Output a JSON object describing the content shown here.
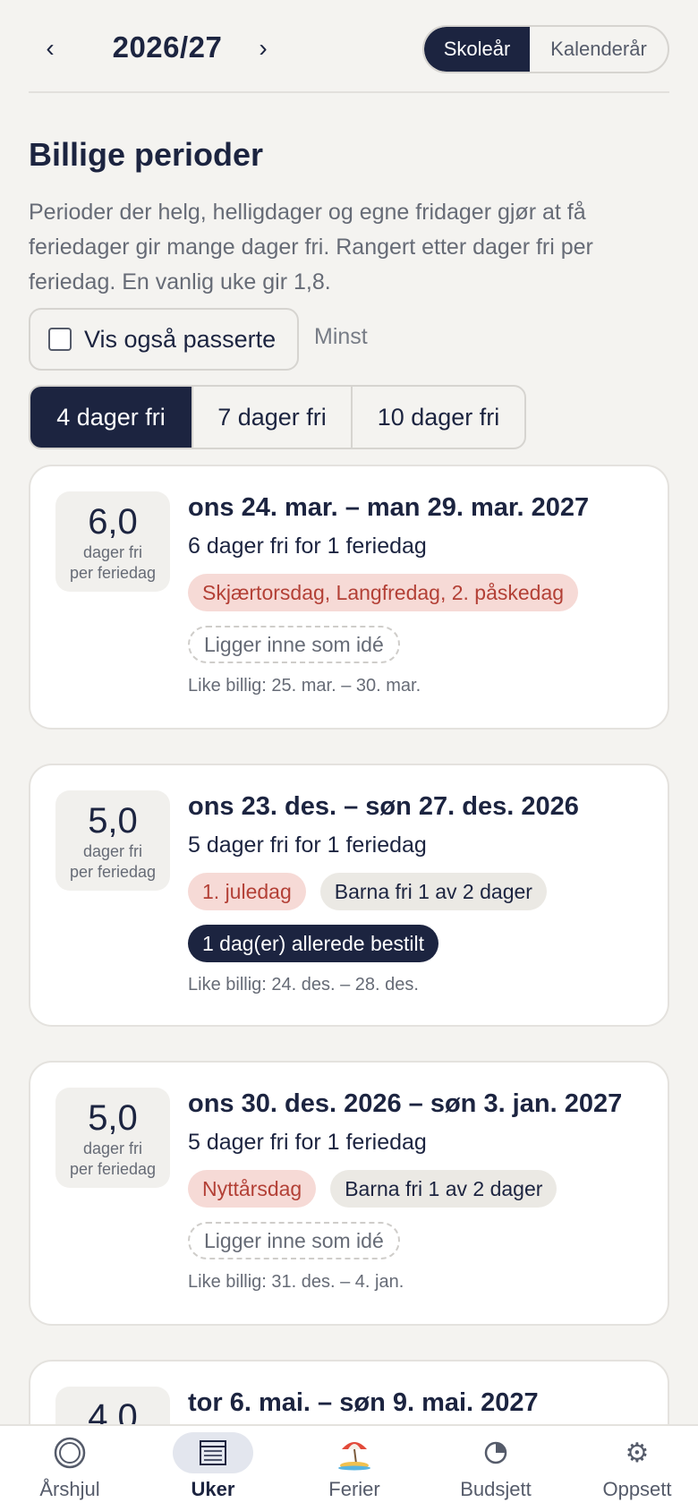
{
  "header": {
    "prev_arrow": "‹",
    "next_arrow": "›",
    "year": "2026/27",
    "toggle_active": "Skoleår",
    "toggle_inactive": "Kalenderår"
  },
  "section": {
    "title": "Billige perioder",
    "description": "Perioder der helg, helligdager og egne fridager gjør at få feriedager gir mange dager fri. Rangert etter dager fri per feriedag. En vanlig uke gir 1,8.",
    "checkbox_label": "Vis også passerte",
    "checkbox_checked": false,
    "sort_label": "Minst"
  },
  "filters": [
    "4 dager fri",
    "7 dager fri",
    "10 dager fri"
  ],
  "score_sub": [
    "dager fri",
    "per feriedag"
  ],
  "cards": [
    {
      "score": "6,0",
      "dates": "ons 24. mar. – man 29. mar. 2027",
      "days": "6 dager fri for 1 feriedag",
      "holiday": "Skjærtorsdag, Langfredag, 2. påskedag",
      "idea": "Ligger inne som idé",
      "alt": "Like billig: 25. mar. – 30. mar."
    },
    {
      "score": "5,0",
      "dates": "ons 23. des. – søn 27. des. 2026",
      "days": "5 dager fri for 1 feriedag",
      "holiday": "1. juledag",
      "kids": "Barna fri 1 av 2 dager",
      "booked": "1 dag(er) allerede bestilt",
      "alt": "Like billig: 24. des. – 28. des."
    },
    {
      "score": "5,0",
      "dates": "ons 30. des. 2026 – søn 3. jan. 2027",
      "days": "5 dager fri for 1 feriedag",
      "holiday": "Nyttårsdag",
      "kids": "Barna fri 1 av 2 dager",
      "idea": "Ligger inne som idé",
      "alt": "Like billig: 31. des. – 4. jan."
    },
    {
      "score": "4,0",
      "dates": "tor 6. mai. – søn 9. mai. 2027"
    }
  ],
  "nav": [
    {
      "label": "Årshjul",
      "icon": "circle-icon"
    },
    {
      "label": "Uker",
      "icon": "list-icon"
    },
    {
      "label": "Ferier",
      "icon": "beach-icon"
    },
    {
      "label": "Budsjett",
      "icon": "pie-icon"
    },
    {
      "label": "Oppsett",
      "icon": "gear-icon"
    }
  ]
}
